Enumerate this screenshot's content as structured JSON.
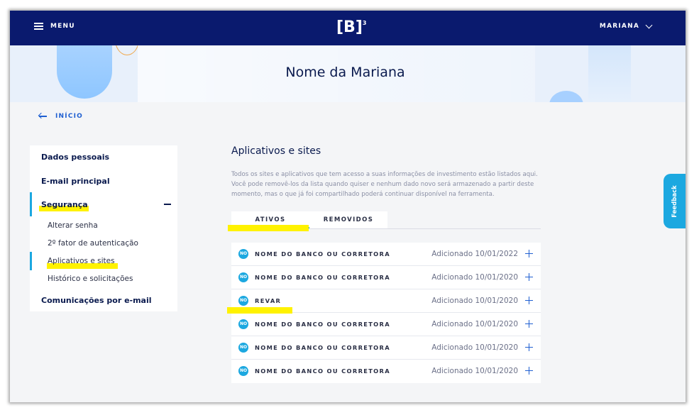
{
  "header": {
    "menu_label": "MENU",
    "logo_text": "[B]",
    "logo_sup": "3",
    "user_label": "MARIANA"
  },
  "banner": {
    "title": "Nome da Mariana"
  },
  "back": {
    "label": "INÍCIO"
  },
  "sidebar": {
    "items": [
      {
        "label": "Dados pessoais"
      },
      {
        "label": "E-mail principal"
      },
      {
        "label": "Segurança"
      },
      {
        "label": "Comunicações por e-mail"
      }
    ],
    "subitems": [
      {
        "label": "Alterar senha"
      },
      {
        "label": "2º fator de autenticação"
      },
      {
        "label": "Aplicativos e sites"
      },
      {
        "label": "Histórico e solicitações"
      }
    ]
  },
  "main": {
    "title": "Aplicativos e sites",
    "description": "Todos os sites e aplicativos que tem acesso a suas informações de investimento estão listados aqui. Você pode removê-los da lista quando quiser e nenhum dado novo será armazenado a partir deste momento, mas o que já foi compartilhado poderá continuar disponível na ferramenta.",
    "tabs": [
      {
        "label": "ATIVOS",
        "active": true
      },
      {
        "label": "REMOVIDOS",
        "active": false
      }
    ],
    "rows": [
      {
        "badge": "NO",
        "name": "NOME DO BANCO OU CORRETORA",
        "date": "Adicionado 10/01/2022"
      },
      {
        "badge": "NO",
        "name": "NOME DO BANCO OU CORRETORA",
        "date": "Adicionado 10/01/2020"
      },
      {
        "badge": "NO",
        "name": "REVAR",
        "date": "Adicionado 10/01/2020"
      },
      {
        "badge": "NO",
        "name": "NOME DO BANCO OU CORRETORA",
        "date": "Adicionado 10/01/2020"
      },
      {
        "badge": "NO",
        "name": "NOME DO BANCO OU CORRETORA",
        "date": "Adicionado 10/01/2020"
      },
      {
        "badge": "NO",
        "name": "NOME DO BANCO OU CORRETORA",
        "date": "Adicionado 10/01/2020"
      }
    ]
  },
  "feedback": {
    "label": "Feedback"
  },
  "colors": {
    "header_bg": "#0a1a6e",
    "accent": "#1ca8e0",
    "link": "#1f5fd1",
    "highlight": "#fff200"
  },
  "icons": {
    "menu": "hamburger-icon",
    "user_dropdown": "chevron-down-icon",
    "back": "arrow-left-icon",
    "collapse": "minus-icon",
    "row_action": "plus-icon"
  }
}
